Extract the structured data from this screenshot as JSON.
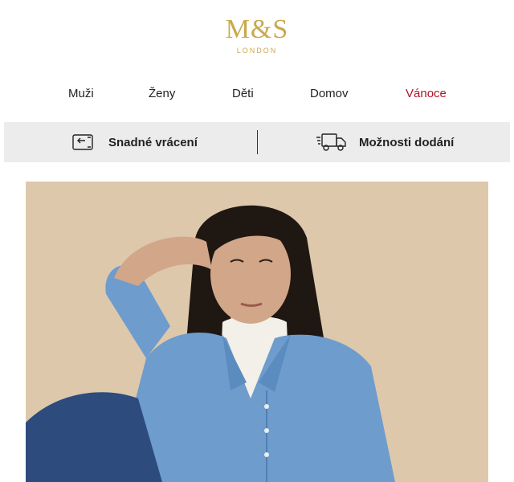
{
  "logo": {
    "mark": "M&S",
    "sub": "LONDON"
  },
  "nav": [
    "Muži",
    "Ženy",
    "Děti",
    "Domov",
    "Vánoce"
  ],
  "services": {
    "returns": {
      "label": "Snadné vrácení",
      "icon": "return-box-icon"
    },
    "delivery": {
      "label": "Možnosti dodání",
      "icon": "delivery-truck-icon"
    }
  },
  "colors": {
    "brand_gold": "#c9a94e",
    "christmas_red": "#b0132a",
    "service_bar_bg": "#ececec",
    "hero_bg": "#ddc8ac"
  }
}
